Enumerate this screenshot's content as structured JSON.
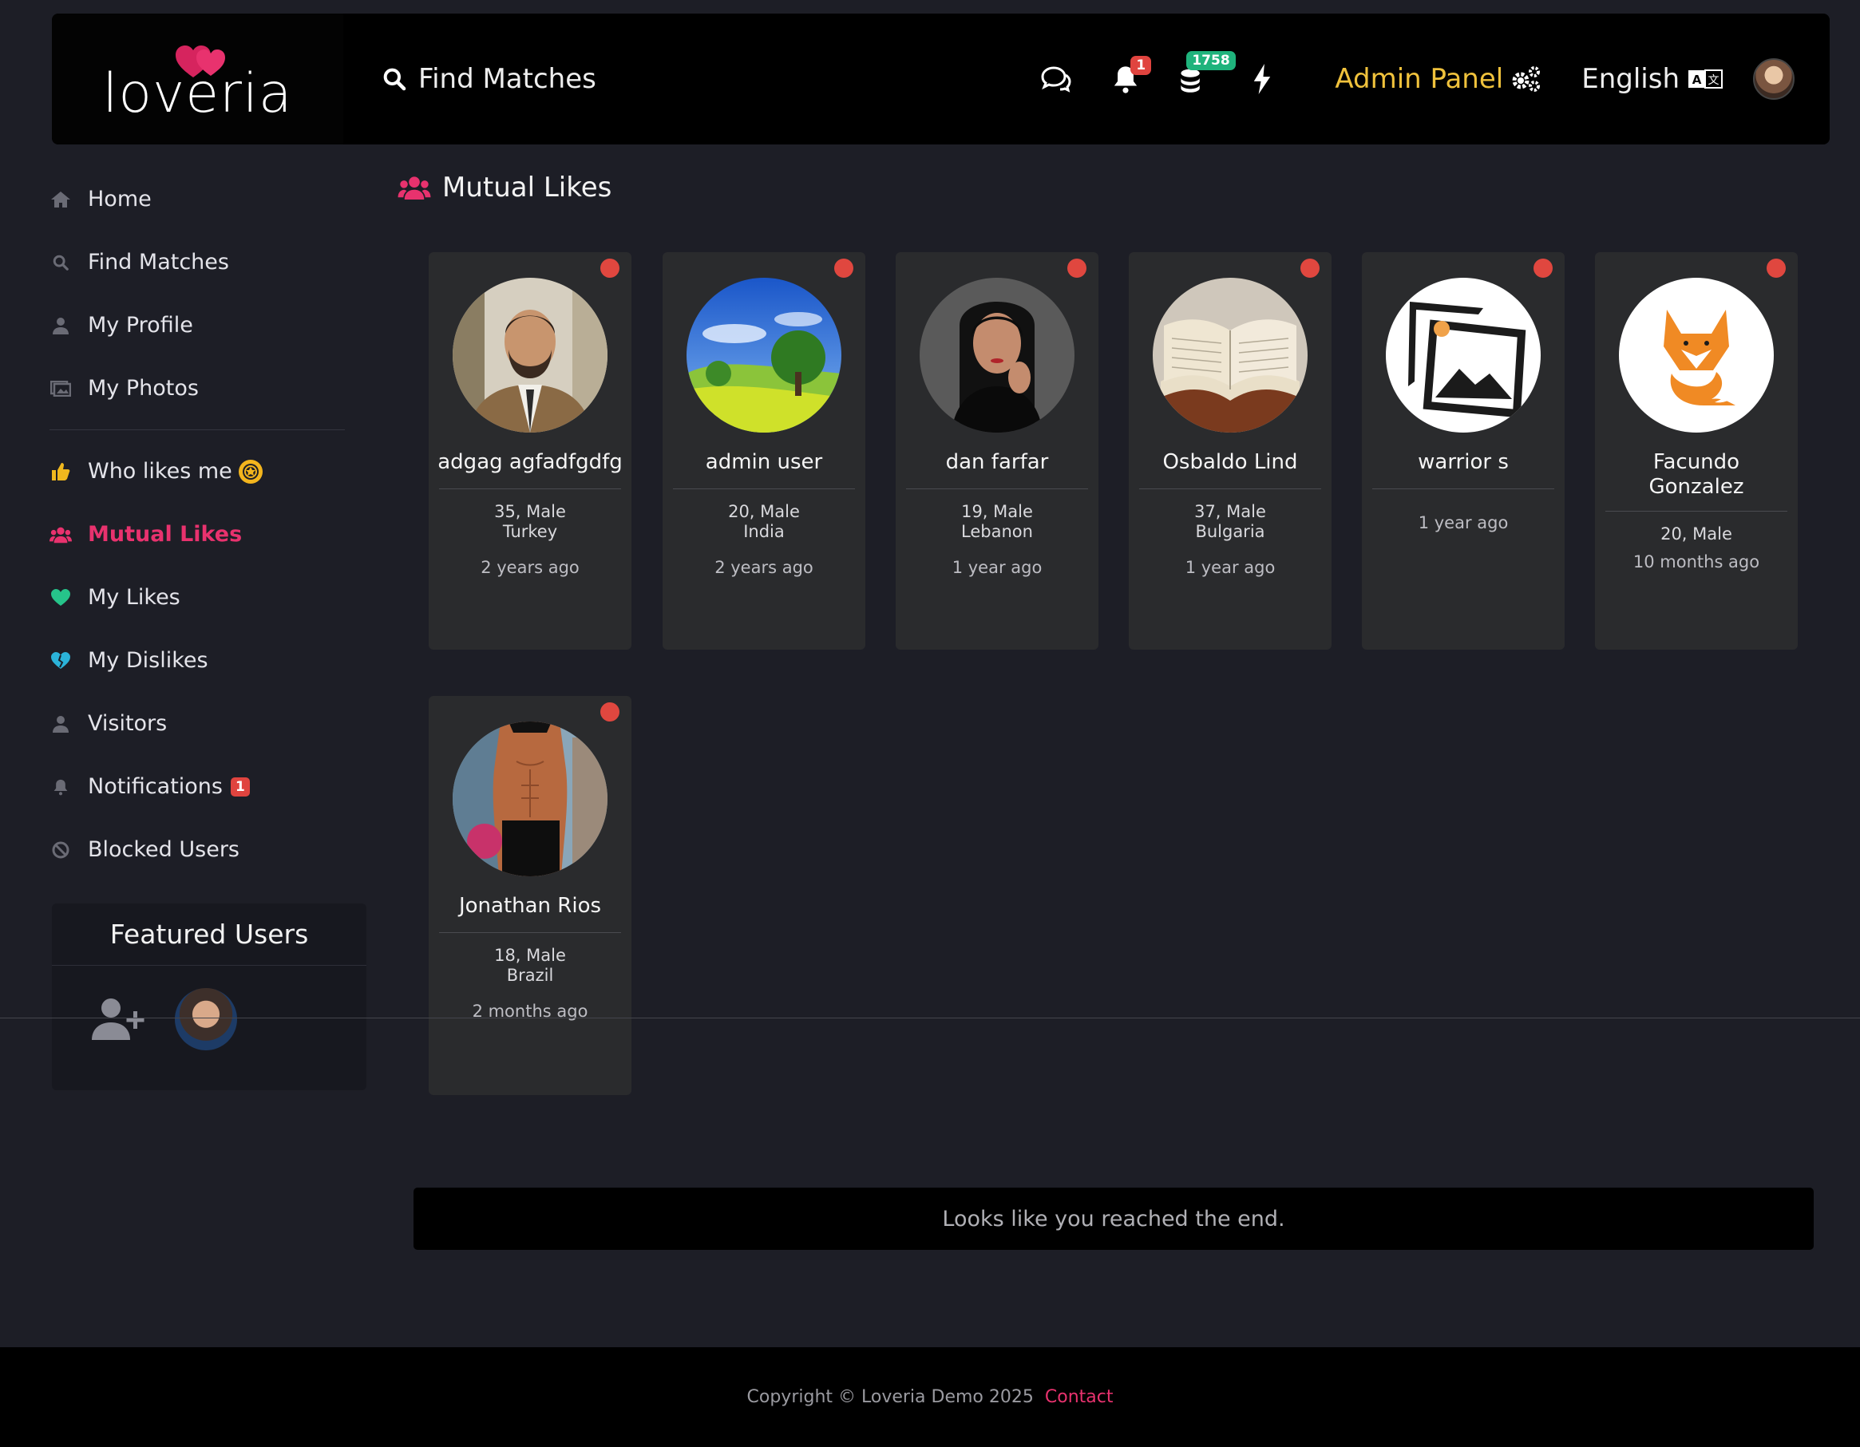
{
  "brand": {
    "name": "loveria",
    "accent": "#e8326e"
  },
  "header": {
    "search_label": "Find Matches",
    "notification_count": "1",
    "credits_count": "1758",
    "admin_panel_label": "Admin Panel",
    "language_label": "English"
  },
  "sidebar": {
    "items": [
      {
        "label": "Home",
        "icon": "home-icon"
      },
      {
        "label": "Find Matches",
        "icon": "search-icon"
      },
      {
        "label": "My Profile",
        "icon": "user-icon"
      },
      {
        "label": "My Photos",
        "icon": "photos-icon"
      },
      {
        "label": "Who likes me",
        "icon": "thumbs-up-icon"
      },
      {
        "label": "Mutual Likes",
        "icon": "users-icon",
        "active": true
      },
      {
        "label": "My Likes",
        "icon": "heart-icon"
      },
      {
        "label": "My Dislikes",
        "icon": "broken-heart-icon"
      },
      {
        "label": "Visitors",
        "icon": "user-icon"
      },
      {
        "label": "Notifications",
        "icon": "bell-icon",
        "badge": "1"
      },
      {
        "label": "Blocked Users",
        "icon": "ban-icon"
      }
    ],
    "featured_title": "Featured Users"
  },
  "main": {
    "title": "Mutual Likes",
    "cards": [
      {
        "name": "adgag agfadfgdfg",
        "age_gender": "35, Male",
        "country": "Turkey",
        "ago": "2 years ago"
      },
      {
        "name": "admin user",
        "age_gender": "20, Male",
        "country": "India",
        "ago": "2 years ago"
      },
      {
        "name": "dan farfar",
        "age_gender": "19, Male",
        "country": "Lebanon",
        "ago": "1 year ago"
      },
      {
        "name": "Osbaldo Lind",
        "age_gender": "37, Male",
        "country": "Bulgaria",
        "ago": "1 year ago"
      },
      {
        "name": "warrior s",
        "age_gender": "",
        "country": "",
        "ago": "1 year ago"
      },
      {
        "name": "Facundo Gonzalez",
        "age_gender": "20, Male",
        "country": "",
        "ago": "10 months ago"
      },
      {
        "name": "Jonathan Rios",
        "age_gender": "18, Male",
        "country": "Brazil",
        "ago": "2 months ago"
      }
    ],
    "end_message": "Looks like you reached the end."
  },
  "footer": {
    "copyright": "Copyright © Loveria Demo 2025",
    "contact": "Contact"
  }
}
